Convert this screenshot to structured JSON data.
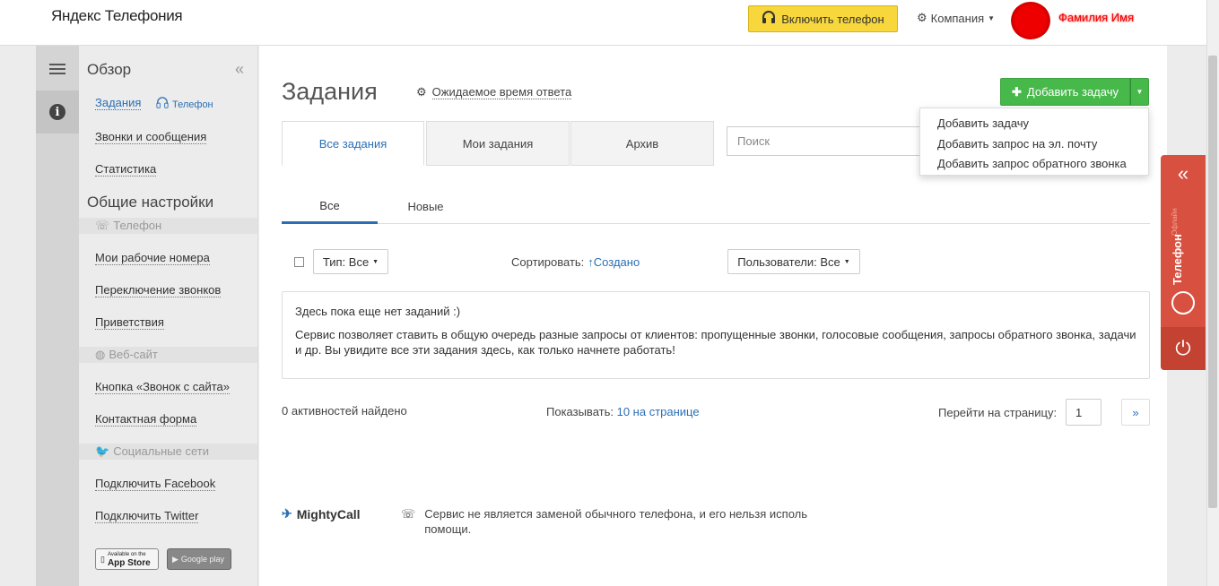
{
  "app": {
    "logo": "Яндекс Телефония"
  },
  "topbar": {
    "phone_button": "Включить телефон",
    "company_menu": "Компания",
    "user_name": "Фамилия Имя"
  },
  "sidebar": {
    "title": "Обзор",
    "items": [
      {
        "label": "Задания"
      },
      {
        "label": "Звонки и сообщения"
      },
      {
        "label": "Статистика"
      }
    ],
    "phone_tag": "Телефон",
    "section_title": "Общие настройки",
    "groups": [
      {
        "label": "Телефон",
        "items": [
          "Мои рабочие номера",
          "Переключение звонков",
          "Приветствия"
        ]
      },
      {
        "label": "Веб-сайт",
        "items": [
          "Кнопка «Звонок с сайта»",
          "Контактная форма"
        ]
      },
      {
        "label": "Социальные сети",
        "items": [
          "Подключить Facebook",
          "Подключить Twitter"
        ]
      }
    ],
    "app_store": "App Store",
    "app_store_small": "Available on the",
    "google_play": "Google play"
  },
  "main": {
    "title": "Задания",
    "response_time": "Ожидаемое время ответа",
    "add_button": "Добавить задачу",
    "dropdown": [
      "Добавить задачу",
      "Добавить запрос на эл. почту",
      "Добавить запрос обратного звонка"
    ],
    "tabs": [
      "Все задания",
      "Мои задания",
      "Архив"
    ],
    "search_placeholder": "Поиск",
    "subtabs": [
      "Все",
      "Новые"
    ],
    "type_filter": "Тип: Все",
    "sort_label": "Сортировать:",
    "sort_value": "Создано",
    "users_filter": "Пользователи: Все",
    "empty_title": "Здесь пока еще нет заданий :)",
    "empty_text": "Сервис позволяет ставить в общую очередь разные запросы от клиентов: пропущенные звонки, голосовые сообщения, запросы обратного звонка, задачи и др. Вы увидите все эти задания здесь, как только начнете работать!",
    "found": "0 активностей найдено",
    "show_label": "Показывать:",
    "show_value": "10 на странице",
    "goto_label": "Перейти на страницу:",
    "page_value": "1",
    "next_label": "»"
  },
  "footer": {
    "brand": "MightyCall",
    "note": "Сервис не является заменой обычного телефона, и его нельзя исполь помощи."
  },
  "widget": {
    "label": "Телефон",
    "small_label": "Офлайн"
  },
  "colors": {
    "accent_blue": "#2a6fb5",
    "add_green": "#47b94b",
    "phone_yellow": "#f8d73c",
    "widget_red": "#d8503f"
  }
}
